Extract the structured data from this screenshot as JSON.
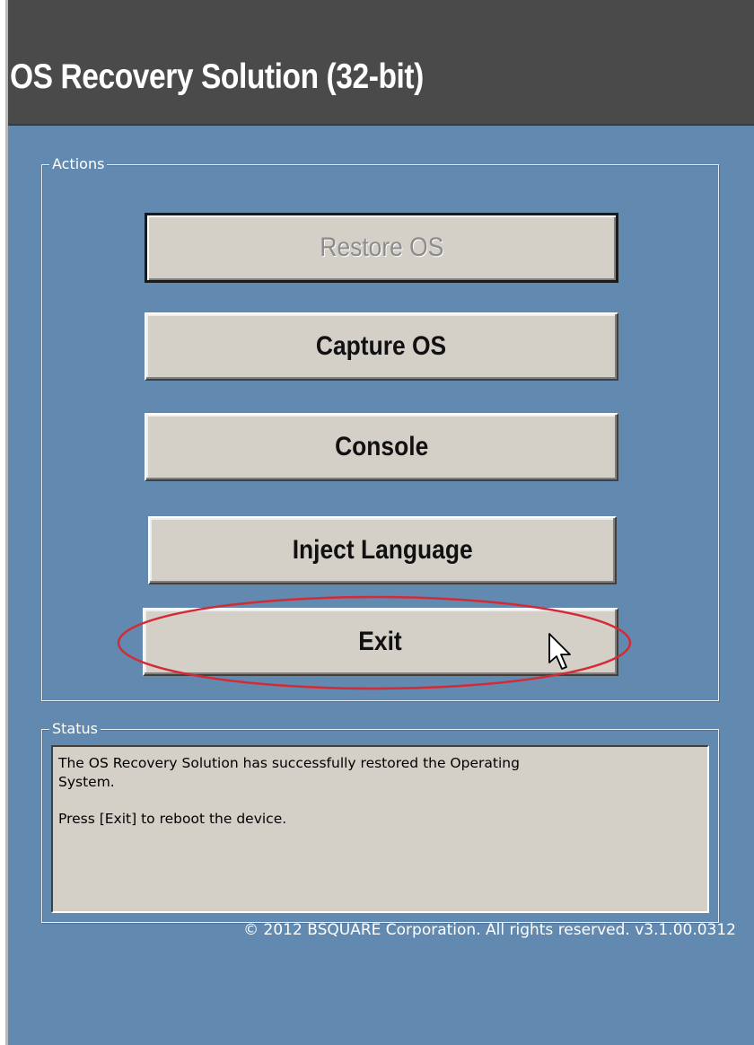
{
  "window": {
    "title": "OS Recovery Solution (32-bit)"
  },
  "actions": {
    "legend": "Actions",
    "buttons": [
      {
        "label": "Restore OS",
        "enabled": false
      },
      {
        "label": "Capture OS",
        "enabled": true
      },
      {
        "label": "Console",
        "enabled": true
      },
      {
        "label": "Inject Language",
        "enabled": true
      },
      {
        "label": "Exit",
        "enabled": true
      }
    ]
  },
  "status": {
    "legend": "Status",
    "line1": "The OS Recovery Solution has successfully restored the Operating",
    "line2": "System.",
    "line3": "Press [Exit] to reboot the device."
  },
  "footer": {
    "copyright": "© 2012 BSQUARE Corporation. All rights reserved. v3.1.00.0312"
  },
  "colors": {
    "window_bg": "#6289b0",
    "title_bar": "#4a4a4a",
    "button_face": "#d4d0c8",
    "highlight_ellipse": "#d42a36"
  },
  "annotations": {
    "highlight_target": "Exit",
    "pointer_icon": "arrow-cursor-icon"
  }
}
